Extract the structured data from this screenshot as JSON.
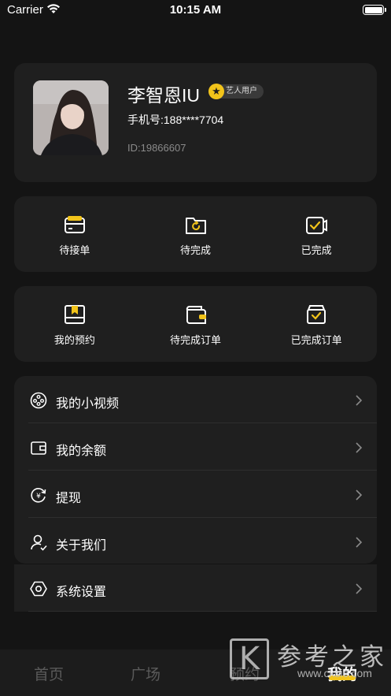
{
  "status_bar": {
    "carrier": "Carrier",
    "time": "10:15 AM"
  },
  "profile": {
    "name": "李智恩IU",
    "badge": "艺人用户",
    "phone": "手机号:188****7704",
    "id": "ID:19866607"
  },
  "orders_row_1": {
    "items": [
      {
        "label": "待接单",
        "icon": "pending-order-icon"
      },
      {
        "label": "待完成",
        "icon": "in-progress-icon"
      },
      {
        "label": "已完成",
        "icon": "completed-icon"
      }
    ]
  },
  "orders_row_2": {
    "items": [
      {
        "label": "我的预约",
        "icon": "reservation-icon"
      },
      {
        "label": "待完成订单",
        "icon": "wallet-order-icon"
      },
      {
        "label": "已完成订单",
        "icon": "completed-order-icon"
      }
    ]
  },
  "menu": {
    "items": [
      {
        "label": "我的小视频",
        "icon": "video-icon"
      },
      {
        "label": "我的余额",
        "icon": "wallet-icon"
      },
      {
        "label": "提现",
        "icon": "withdraw-icon"
      },
      {
        "label": "关于我们",
        "icon": "user-icon"
      },
      {
        "label": "系统设置",
        "icon": "settings-icon"
      }
    ]
  },
  "tab_bar": {
    "tabs": [
      {
        "label": "首页"
      },
      {
        "label": "广场"
      },
      {
        "label": "预约"
      },
      {
        "label": "我的"
      }
    ],
    "active": "我的"
  },
  "watermark": {
    "logo_letter": "K",
    "text": "参考之家",
    "url": "www.cksic.com"
  },
  "colors": {
    "background": "#141414",
    "card": "#1f1f1f",
    "accent": "#f2c41a"
  }
}
